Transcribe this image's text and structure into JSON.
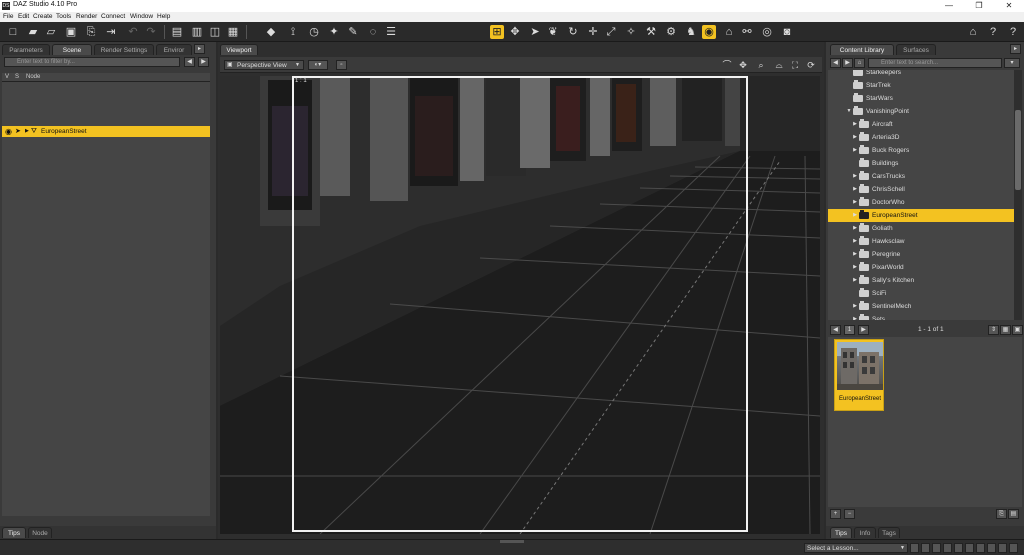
{
  "window": {
    "title": "DAZ Studio 4.10 Pro",
    "icon": "DS",
    "controls": {
      "minimize": "—",
      "maximize": "❐",
      "close": "✕"
    }
  },
  "menu": [
    "File",
    "Edit",
    "Create",
    "Tools",
    "Render",
    "Connect",
    "Window",
    "Help"
  ],
  "left_pane": {
    "tabs": [
      "Parameters",
      "Scene",
      "Render Settings",
      "Enviror"
    ],
    "active_tab": "Scene",
    "filter_placeholder": "Enter text to filter by...",
    "columns": [
      "V",
      "S",
      "Node"
    ],
    "selected_node": "EuropeanStreet",
    "bottom_tabs": [
      "Tips",
      "Node"
    ]
  },
  "viewport": {
    "tab": "Viewport",
    "camera": "Perspective View",
    "aspect_label": "1 : 1"
  },
  "right_pane": {
    "tabs": [
      "Content Library",
      "Surfaces"
    ],
    "active_tab": "Content Library",
    "filter_placeholder": "Enter text to search...",
    "tree": [
      {
        "label": "Starkeepers",
        "level": 1,
        "arrow": ""
      },
      {
        "label": "StarTrek",
        "level": 1,
        "arrow": ""
      },
      {
        "label": "StarWars",
        "level": 1,
        "arrow": ""
      },
      {
        "label": "VanishingPoint",
        "level": 1,
        "arrow": "▼"
      },
      {
        "label": "Aircraft",
        "level": 2,
        "arrow": "▶"
      },
      {
        "label": "Arteria3D",
        "level": 2,
        "arrow": "▶"
      },
      {
        "label": "Buck Rogers",
        "level": 2,
        "arrow": "▶"
      },
      {
        "label": "Buildings",
        "level": 2,
        "arrow": ""
      },
      {
        "label": "CarsTrucks",
        "level": 2,
        "arrow": "▶"
      },
      {
        "label": "ChrisSchell",
        "level": 2,
        "arrow": "▶"
      },
      {
        "label": "DoctorWho",
        "level": 2,
        "arrow": "▶"
      },
      {
        "label": "EuropeanStreet",
        "level": 2,
        "arrow": "▶",
        "selected": true
      },
      {
        "label": "Goliath",
        "level": 2,
        "arrow": "▶"
      },
      {
        "label": "Hawksclaw",
        "level": 2,
        "arrow": "▶"
      },
      {
        "label": "Peregrine",
        "level": 2,
        "arrow": "▶"
      },
      {
        "label": "PixarWorld",
        "level": 2,
        "arrow": "▶"
      },
      {
        "label": "Sally's Kitchen",
        "level": 2,
        "arrow": "▶"
      },
      {
        "label": "SciFi",
        "level": 2,
        "arrow": ""
      },
      {
        "label": "SentinelMech",
        "level": 2,
        "arrow": "▶"
      },
      {
        "label": "Sets",
        "level": 2,
        "arrow": "▶"
      }
    ],
    "pager": {
      "page": "1",
      "range": "1 - 1 of 1"
    },
    "thumbnail_label": "EuropeanStreet",
    "bottom_tabs": [
      "Tips",
      "Info",
      "Tags"
    ]
  },
  "status": {
    "lesson_placeholder": "Select a Lesson..."
  },
  "colors": {
    "accent": "#f3c221",
    "panel": "#3a3a3a",
    "list": "#454545"
  }
}
